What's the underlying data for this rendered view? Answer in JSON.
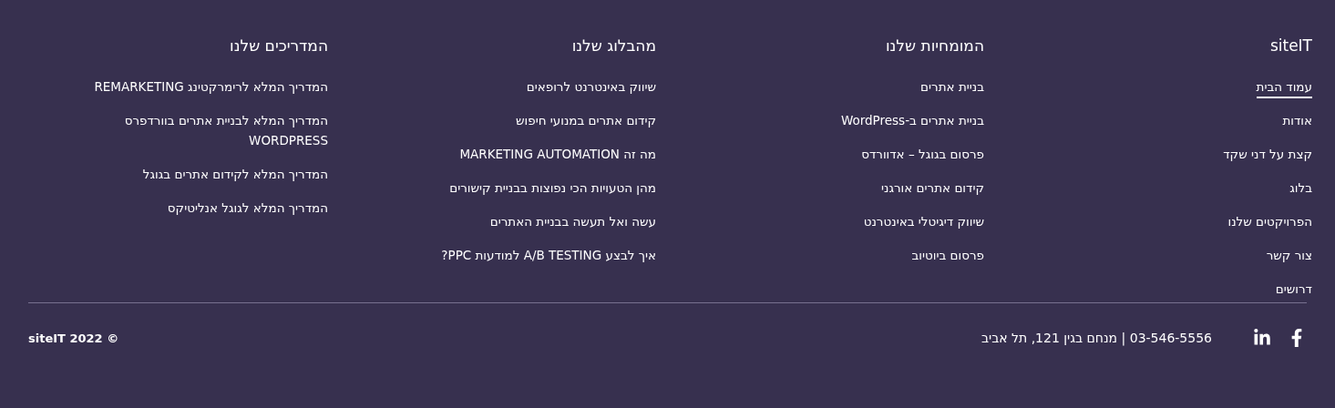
{
  "columns": [
    {
      "title": "siteIT",
      "links": [
        {
          "label": "עמוד הבית",
          "selected": true
        },
        {
          "label": "אודות",
          "selected": false
        },
        {
          "label": "קצת על דני שקד",
          "selected": false
        },
        {
          "label": "בלוג",
          "selected": false
        },
        {
          "label": "הפרויקטים שלנו",
          "selected": false
        },
        {
          "label": "צור קשר",
          "selected": false
        },
        {
          "label": "דרושים",
          "selected": false
        }
      ]
    },
    {
      "title": "המומחיות שלנו",
      "links": [
        {
          "label": "בניית אתרים",
          "selected": false
        },
        {
          "label": "בניית אתרים ב-WordPress",
          "selected": false
        },
        {
          "label": "פרסום בגוגל – אדוורדס",
          "selected": false
        },
        {
          "label": "קידום אתרים אורגני",
          "selected": false
        },
        {
          "label": "שיווק דיגיטלי באינטרנט",
          "selected": false
        },
        {
          "label": "פרסום ביוטיוב",
          "selected": false
        }
      ]
    },
    {
      "title": "מהבלוג שלנו",
      "links": [
        {
          "label": "שיווק באינטרנט לרופאים",
          "selected": false
        },
        {
          "label": "קידום אתרים במנועי חיפוש",
          "selected": false
        },
        {
          "label": "מה זה MARKETING AUTOMATION",
          "selected": false
        },
        {
          "label": "מהן הטעויות הכי נפוצות בבניית קישורים",
          "selected": false
        },
        {
          "label": "עשה ואל תעשה בבניית האתרים",
          "selected": false
        },
        {
          "label": "איך לבצע A/B TESTING למודעות PPC?",
          "selected": false
        }
      ]
    },
    {
      "title": "המדריכים שלנו",
      "links": [
        {
          "label": "המדריך המלא לרימרקטינג REMARKETING",
          "selected": false
        },
        {
          "label": "המדריך המלא לבניית אתרים בוורדפרס WORDPRESS",
          "selected": false
        },
        {
          "label": "המדריך המלא לקידום אתרים בגוגל",
          "selected": false
        },
        {
          "label": "המדריך המלא לגוגל אנליטיקס",
          "selected": false
        }
      ]
    }
  ],
  "bottom": {
    "socials": [
      {
        "kind": "facebook"
      },
      {
        "kind": "linkedin"
      }
    ],
    "contact": "03-546-5556 | מנחם בגין 121, תל אביב",
    "copyright": "© siteIT 2022"
  }
}
